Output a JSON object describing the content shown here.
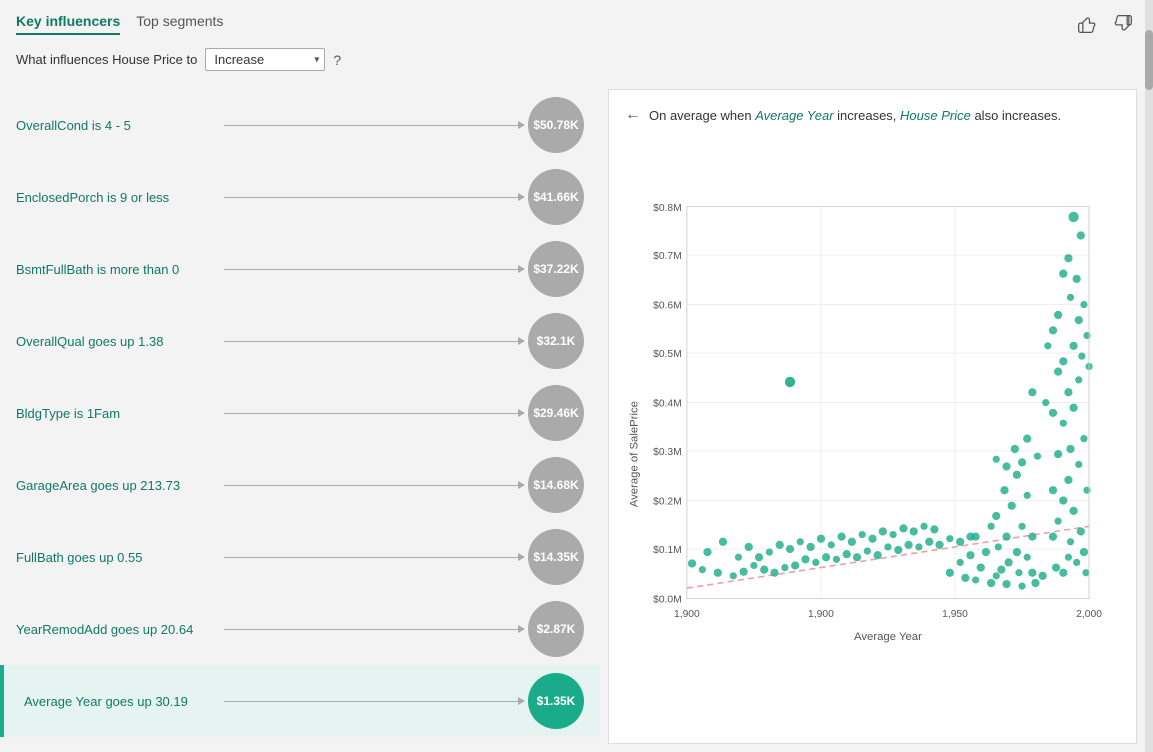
{
  "tabs": [
    {
      "label": "Key influencers",
      "active": true
    },
    {
      "label": "Top segments",
      "active": false
    }
  ],
  "filter": {
    "label": "What influences House Price to",
    "value": "Increase",
    "help": "?"
  },
  "influencers": [
    {
      "label": "OverallCond is 4 - 5",
      "value": "$50.78K",
      "highlighted": false
    },
    {
      "label": "EnclosedPorch is 9 or less",
      "value": "$41.66K",
      "highlighted": false
    },
    {
      "label": "BsmtFullBath is more than 0",
      "value": "$37.22K",
      "highlighted": false
    },
    {
      "label": "OverallQual goes up 1.38",
      "value": "$32.1K",
      "highlighted": false
    },
    {
      "label": "BldgType is 1Fam",
      "value": "$29.46K",
      "highlighted": false
    },
    {
      "label": "GarageArea goes up 213.73",
      "value": "$14.68K",
      "highlighted": false
    },
    {
      "label": "FullBath goes up 0.55",
      "value": "$14.35K",
      "highlighted": false
    },
    {
      "label": "YearRemodAdd goes up 20.64",
      "value": "$2.87K",
      "highlighted": false
    },
    {
      "label": "Average Year goes up 30.19",
      "value": "$1.35K",
      "highlighted": true
    }
  ],
  "chart": {
    "back_label": "←",
    "description_prefix": "On average when",
    "subject": "Average Year",
    "verb": "increases,",
    "object": "House Price",
    "result": "also increases.",
    "x_label": "Average Year",
    "y_label": "Average of SalePrice",
    "x_ticks": [
      "1,900",
      "1,950",
      "2,000"
    ],
    "y_ticks": [
      "$0.0M",
      "$0.1M",
      "$0.2M",
      "$0.3M",
      "$0.4M",
      "$0.5M",
      "$0.6M",
      "$0.7M",
      "$0.8M"
    ]
  }
}
